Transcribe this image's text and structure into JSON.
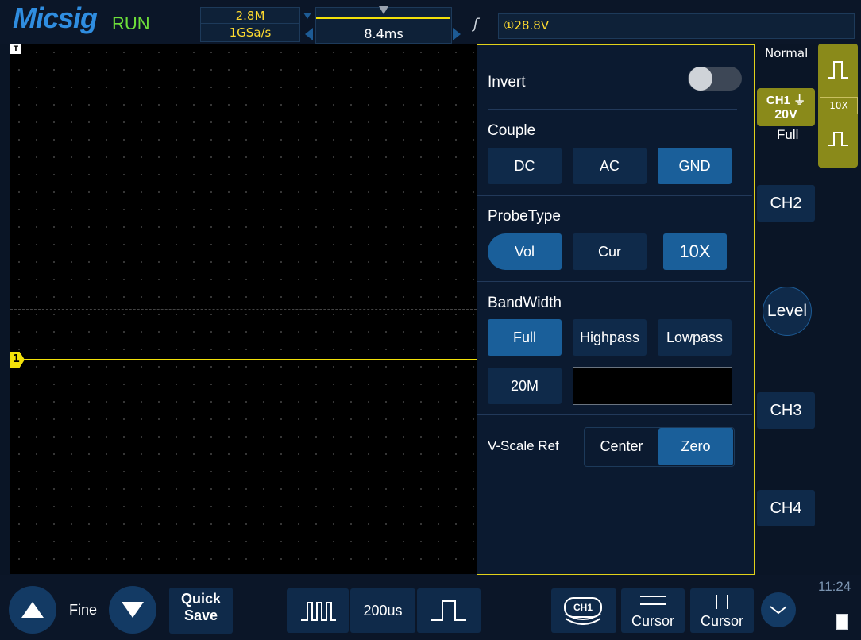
{
  "topbar": {
    "brand": "Micsig",
    "run_state": "RUN",
    "memory_depth": "2.8M",
    "sample_rate": "1GSa/s",
    "timebase": "8.4ms",
    "trigger_value": "①28.8V",
    "trigger_mode": "Normal"
  },
  "screen": {
    "trigger_marker": "T",
    "ch1_marker": "1"
  },
  "panel": {
    "invert_label": "Invert",
    "invert_on": false,
    "couple_label": "Couple",
    "couple_options": [
      "DC",
      "AC",
      "GND"
    ],
    "couple_selected": "GND",
    "probe_label": "ProbeType",
    "probe_options": [
      "Vol",
      "Cur"
    ],
    "probe_selected": "Vol",
    "probe_ratio": "10X",
    "bandwidth_label": "BandWidth",
    "bandwidth_options": [
      "Full",
      "Highpass",
      "Lowpass"
    ],
    "bandwidth_selected": "Full",
    "bandwidth_20m": "20M",
    "bandwidth_input_value": "",
    "vscale_label": "V-Scale Ref",
    "vscale_options": [
      "Center",
      "Zero"
    ],
    "vscale_selected": "Zero"
  },
  "right": {
    "ch1_label": "CH1",
    "ch1_scale": "20V",
    "ch1_bw": "Full",
    "probe_ratio_tag": "10X",
    "ch2": "CH2",
    "ch3": "CH3",
    "ch4": "CH4",
    "level": "Level"
  },
  "bottom": {
    "fine": "Fine",
    "quick": "Quick",
    "save": "Save",
    "timebase": "200us",
    "ch1_tag": "CH1",
    "cursor1": "Cursor",
    "cursor2": "Cursor",
    "clock": "11:24"
  }
}
